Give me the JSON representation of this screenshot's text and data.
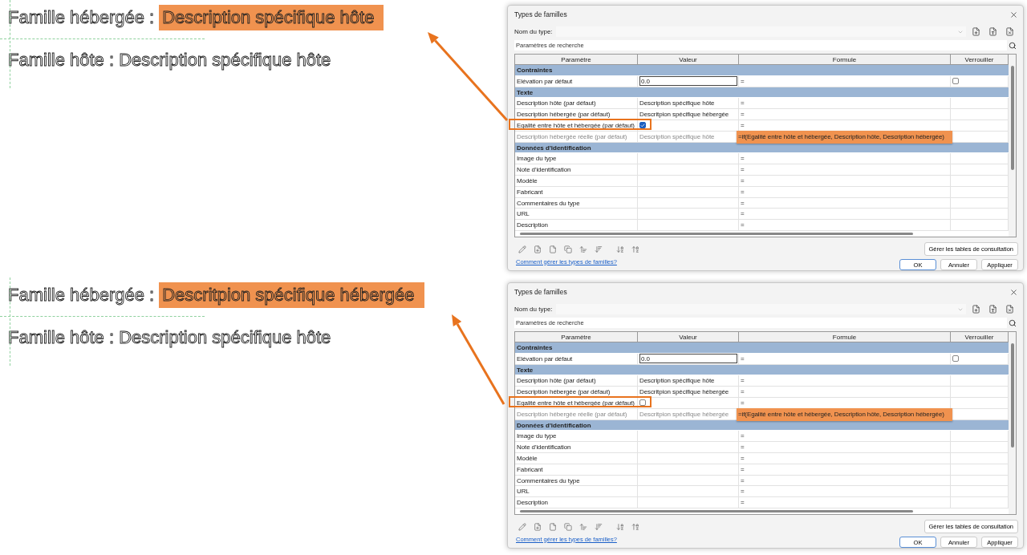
{
  "panels": [
    {
      "canvas": {
        "hosted_label": "Famille hébergée :",
        "hosted_value": "Description spécifique hôte",
        "host_line": "Famille hôte : Description spécifique hôte"
      },
      "dialog": {
        "title": "Types de familles",
        "type_name_label": "Nom du type:",
        "search_placeholder": "Paramètres de recherche",
        "columns": [
          "Paramètre",
          "Valeur",
          "Formule",
          "Verrouiller"
        ],
        "rows": [
          {
            "kind": "group",
            "label": "Contraintes"
          },
          {
            "kind": "field_param",
            "name": "Elévation par défaut",
            "value": "0.0",
            "formula": "=",
            "locked": false,
            "disabled": false,
            "outlined": false,
            "annotated": false
          },
          {
            "kind": "group",
            "label": "Texte"
          },
          {
            "kind": "text_param",
            "name": "Description hôte (par défaut)",
            "value": "Description spécifique hôte",
            "formula": "=",
            "disabled": false,
            "outlined": false,
            "annotated": false
          },
          {
            "kind": "text_param",
            "name": "Description hébergée (par défaut)",
            "value": "Descritpion spécifique hébergée",
            "formula": "=",
            "disabled": false,
            "outlined": false,
            "annotated": false
          },
          {
            "kind": "checkbox_param",
            "name": "Egalité entre hôte et hébergée (par défaut)",
            "checked": true,
            "formula": "=",
            "disabled": false,
            "outlined": true,
            "annotated": false
          },
          {
            "kind": "text_param",
            "name": "Description hébergée réelle (par défaut)",
            "value": "Description spécifique hôte",
            "formula": "=if(Egalité entre hôte et hébergée, Description hôte, Description hébergée)",
            "disabled": true,
            "outlined": false,
            "annotated": true
          },
          {
            "kind": "group",
            "label": "Données d'identification"
          },
          {
            "kind": "text_param",
            "name": "Image du type",
            "formula": "=",
            "disabled": false,
            "outlined": false,
            "annotated": false
          },
          {
            "kind": "text_param",
            "name": "Note d'identification",
            "formula": "=",
            "disabled": false,
            "outlined": false,
            "annotated": false
          },
          {
            "kind": "text_param",
            "name": "Modèle",
            "formula": "=",
            "disabled": false,
            "outlined": false,
            "annotated": false
          },
          {
            "kind": "text_param",
            "name": "Fabricant",
            "formula": "=",
            "disabled": false,
            "outlined": false,
            "annotated": false
          },
          {
            "kind": "text_param",
            "name": "Commentaires du type",
            "formula": "=",
            "disabled": false,
            "outlined": false,
            "annotated": false
          },
          {
            "kind": "text_param",
            "name": "URL",
            "formula": "=",
            "disabled": false,
            "outlined": false,
            "annotated": false
          },
          {
            "kind": "text_param",
            "name": "Description",
            "formula": "=",
            "disabled": false,
            "outlined": false,
            "annotated": false
          }
        ],
        "lookup_button": "Gérer les tables de consultation",
        "help_link": "Comment gérer les types de familles?",
        "buttons": [
          "OK",
          "Annuler",
          "Appliquer"
        ]
      }
    },
    {
      "canvas": {
        "hosted_label": "Famille hébergée :",
        "hosted_value": "Descritpion spécifique hébergée",
        "host_line": "Famille hôte : Description spécifique hôte"
      },
      "dialog": {
        "title": "Types de familles",
        "type_name_label": "Nom du type:",
        "search_placeholder": "Paramètres de recherche",
        "columns": [
          "Paramètre",
          "Valeur",
          "Formule",
          "Verrouiller"
        ],
        "rows": [
          {
            "kind": "group",
            "label": "Contraintes"
          },
          {
            "kind": "field_param",
            "name": "Elévation par défaut",
            "value": "0.0",
            "formula": "=",
            "locked": false,
            "disabled": false,
            "outlined": false,
            "annotated": false
          },
          {
            "kind": "group",
            "label": "Texte"
          },
          {
            "kind": "text_param",
            "name": "Description hôte (par défaut)",
            "value": "Description spécifique hôte",
            "formula": "=",
            "disabled": false,
            "outlined": false,
            "annotated": false
          },
          {
            "kind": "text_param",
            "name": "Description hébergée (par défaut)",
            "value": "Descritpion spécifique hébergée",
            "formula": "=",
            "disabled": false,
            "outlined": false,
            "annotated": false
          },
          {
            "kind": "checkbox_param",
            "name": "Egalité entre hôte et hébergée (par défaut)",
            "checked": false,
            "formula": "=",
            "disabled": false,
            "outlined": true,
            "annotated": false
          },
          {
            "kind": "text_param",
            "name": "Description hébergée réelle (par défaut)",
            "value": "Descritpion spécifique hébergée",
            "formula": "=if(Egalité entre hôte et hébergée, Description hôte, Description hébergée)",
            "disabled": true,
            "outlined": false,
            "annotated": true
          },
          {
            "kind": "group",
            "label": "Données d'identification"
          },
          {
            "kind": "text_param",
            "name": "Image du type",
            "formula": "=",
            "disabled": false,
            "outlined": false,
            "annotated": false
          },
          {
            "kind": "text_param",
            "name": "Note d'identification",
            "formula": "=",
            "disabled": false,
            "outlined": false,
            "annotated": false
          },
          {
            "kind": "text_param",
            "name": "Modèle",
            "formula": "=",
            "disabled": false,
            "outlined": false,
            "annotated": false
          },
          {
            "kind": "text_param",
            "name": "Fabricant",
            "formula": "=",
            "disabled": false,
            "outlined": false,
            "annotated": false
          },
          {
            "kind": "text_param",
            "name": "Commentaires du type",
            "formula": "=",
            "disabled": false,
            "outlined": false,
            "annotated": false
          },
          {
            "kind": "text_param",
            "name": "URL",
            "formula": "=",
            "disabled": false,
            "outlined": false,
            "annotated": false
          },
          {
            "kind": "text_param",
            "name": "Description",
            "formula": "=",
            "disabled": false,
            "outlined": false,
            "annotated": false
          }
        ],
        "lookup_button": "Gérer les tables de consultation",
        "help_link": "Comment gérer les types de familles?",
        "buttons": [
          "OK",
          "Annuler",
          "Appliquer"
        ]
      }
    }
  ]
}
